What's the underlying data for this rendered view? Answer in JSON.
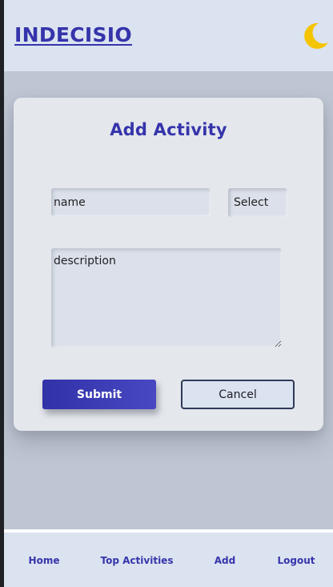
{
  "header": {
    "brand": "INDECISIO",
    "theme_icon": "moon-icon",
    "moon_color": "#f5c400"
  },
  "form": {
    "title": "Add Activity",
    "name_placeholder": "name",
    "type_select_value": "Select a",
    "description_placeholder": "description",
    "submit_label": "Submit",
    "cancel_label": "Cancel"
  },
  "nav": {
    "items": [
      {
        "label": "Home"
      },
      {
        "label": "Top Activities"
      },
      {
        "label": "Add"
      },
      {
        "label": "Logout"
      }
    ]
  },
  "colors": {
    "accent": "#3534ab",
    "surface": "#dbe3f0",
    "background": "#bfc6d3"
  }
}
